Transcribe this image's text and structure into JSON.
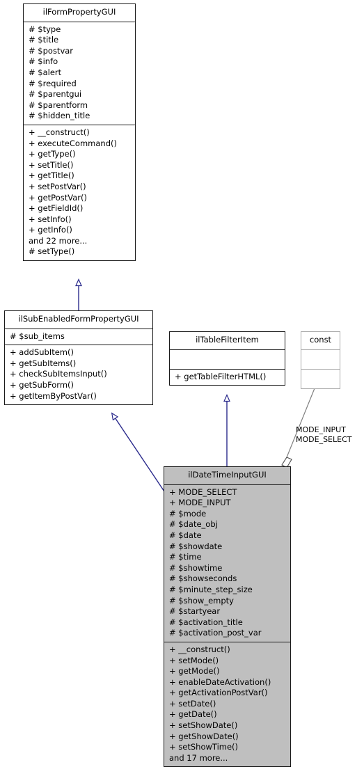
{
  "diagram": {
    "type": "uml-class-diagram",
    "title": "ilDateTimeInputGUI class hierarchy",
    "accent_colors": {
      "inheritance_arrow": "#2a2a8c",
      "association_line": "#7f7f7f",
      "class_fill_highlight": "#bfbfbf",
      "class_border": "#191919",
      "faint_border": "#a8a8a8"
    }
  },
  "classes": {
    "form_property_gui": {
      "name": "ilFormPropertyGUI",
      "attributes": [
        "# $type",
        "# $title",
        "# $postvar",
        "# $info",
        "# $alert",
        "# $required",
        "# $parentgui",
        "# $parentform",
        "# $hidden_title"
      ],
      "methods": [
        "+ __construct()",
        "+ executeCommand()",
        "+ getType()",
        "+ setTitle()",
        "+ getTitle()",
        "+ setPostVar()",
        "+ getPostVar()",
        "+ getFieldId()",
        "+ setInfo()",
        "+ getInfo()",
        "and 22 more...",
        "# setType()"
      ]
    },
    "sub_enabled_form_property_gui": {
      "name": "ilSubEnabledFormPropertyGUI",
      "attributes": [
        "# $sub_items"
      ],
      "methods": [
        "+ addSubItem()",
        "+ getSubItems()",
        "+ checkSubItemsInput()",
        "+ getSubForm()",
        "+ getItemByPostVar()"
      ]
    },
    "table_filter_item": {
      "name": "ilTableFilterItem",
      "attributes": [],
      "methods": [
        "+ getTableFilterHTML()"
      ]
    },
    "const_box": {
      "name": "const",
      "attributes": [],
      "methods": []
    },
    "date_time_input_gui": {
      "name": "ilDateTimeInputGUI",
      "attributes": [
        "+ MODE_SELECT",
        "+ MODE_INPUT",
        "# $mode",
        "# $date_obj",
        "# $date",
        "# $showdate",
        "# $time",
        "# $showtime",
        "# $showseconds",
        "# $minute_step_size",
        "# $show_empty",
        "# $startyear",
        "# $activation_title",
        "# $activation_post_var"
      ],
      "methods": [
        "+ __construct()",
        "+ setMode()",
        "+ getMode()",
        "+ enableDateActivation()",
        "+ getActivationPostVar()",
        "+ setDate()",
        "+ getDate()",
        "+ setShowDate()",
        "+ getShowDate()",
        "+ setShowTime()",
        "and 17 more..."
      ]
    }
  },
  "edges": {
    "association_label": {
      "line1": "MODE_INPUT",
      "line2": "MODE_SELECT"
    }
  }
}
